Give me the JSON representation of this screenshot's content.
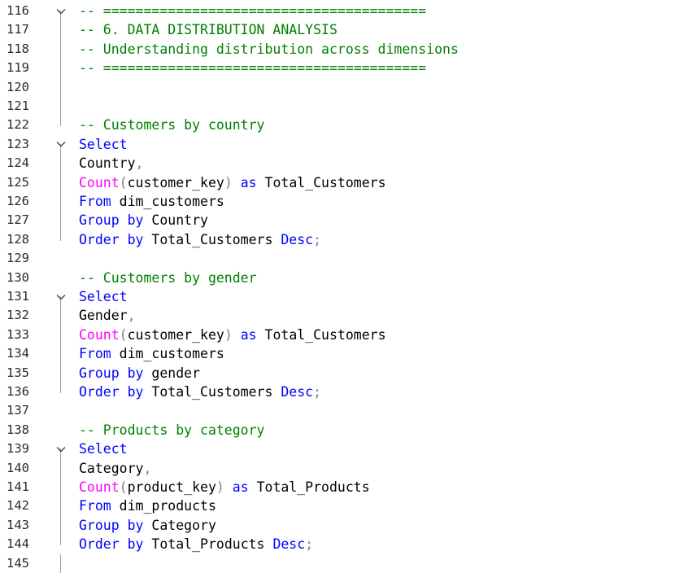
{
  "editor": {
    "language": "SQL",
    "colors": {
      "comment": "#008000",
      "keyword": "#0000ff",
      "function": "#ff00ff",
      "punctuation": "#808080",
      "identifier": "#000000",
      "line_number": "#2b2b2b"
    },
    "lines": [
      {
        "num": "116",
        "fold": "chevron-down-icon",
        "guide": "start",
        "tokens": [
          {
            "t": "-- ========================================",
            "c": "cm"
          }
        ]
      },
      {
        "num": "117",
        "guide": "mid",
        "tokens": [
          {
            "t": "-- 6. DATA DISTRIBUTION ANALYSIS",
            "c": "cm"
          }
        ]
      },
      {
        "num": "118",
        "guide": "mid",
        "tokens": [
          {
            "t": "-- Understanding distribution across dimensions",
            "c": "cm"
          }
        ]
      },
      {
        "num": "119",
        "guide": "mid",
        "tokens": [
          {
            "t": "-- ========================================",
            "c": "cm"
          }
        ]
      },
      {
        "num": "120",
        "guide": "mid",
        "tokens": []
      },
      {
        "num": "121",
        "guide": "mid",
        "tokens": []
      },
      {
        "num": "122",
        "guide": "end",
        "tokens": [
          {
            "t": "-- Customers by country",
            "c": "cm"
          }
        ]
      },
      {
        "num": "123",
        "fold": "chevron-down-icon",
        "guide": "start",
        "tokens": [
          {
            "t": "Select",
            "c": "kw"
          }
        ]
      },
      {
        "num": "124",
        "guide": "mid",
        "tokens": [
          {
            "t": "Country",
            "c": "id"
          },
          {
            "t": ",",
            "c": "pn"
          }
        ]
      },
      {
        "num": "125",
        "guide": "mid",
        "tokens": [
          {
            "t": "Count",
            "c": "fn"
          },
          {
            "t": "(",
            "c": "pn"
          },
          {
            "t": "customer_key",
            "c": "id"
          },
          {
            "t": ")",
            "c": "pn"
          },
          {
            "t": " ",
            "c": "id"
          },
          {
            "t": "as",
            "c": "kw"
          },
          {
            "t": " Total_Customers",
            "c": "id"
          }
        ]
      },
      {
        "num": "126",
        "guide": "mid",
        "tokens": [
          {
            "t": "From",
            "c": "kw"
          },
          {
            "t": " dim_customers",
            "c": "id"
          }
        ]
      },
      {
        "num": "127",
        "guide": "mid",
        "tokens": [
          {
            "t": "Group by",
            "c": "kw"
          },
          {
            "t": " Country",
            "c": "id"
          }
        ]
      },
      {
        "num": "128",
        "guide": "end",
        "tokens": [
          {
            "t": "Order by",
            "c": "kw"
          },
          {
            "t": " Total_Customers ",
            "c": "id"
          },
          {
            "t": "Desc",
            "c": "kw"
          },
          {
            "t": ";",
            "c": "pn"
          }
        ]
      },
      {
        "num": "129",
        "tokens": []
      },
      {
        "num": "130",
        "tokens": [
          {
            "t": "-- Customers by gender",
            "c": "cm"
          }
        ]
      },
      {
        "num": "131",
        "fold": "chevron-down-icon",
        "guide": "start",
        "tokens": [
          {
            "t": "Select",
            "c": "kw"
          }
        ]
      },
      {
        "num": "132",
        "guide": "mid",
        "tokens": [
          {
            "t": "Gender",
            "c": "id"
          },
          {
            "t": ",",
            "c": "pn"
          }
        ]
      },
      {
        "num": "133",
        "guide": "mid",
        "tokens": [
          {
            "t": "Count",
            "c": "fn"
          },
          {
            "t": "(",
            "c": "pn"
          },
          {
            "t": "customer_key",
            "c": "id"
          },
          {
            "t": ")",
            "c": "pn"
          },
          {
            "t": " ",
            "c": "id"
          },
          {
            "t": "as",
            "c": "kw"
          },
          {
            "t": " Total_Customers",
            "c": "id"
          }
        ]
      },
      {
        "num": "134",
        "guide": "mid",
        "tokens": [
          {
            "t": "From",
            "c": "kw"
          },
          {
            "t": " dim_customers",
            "c": "id"
          }
        ]
      },
      {
        "num": "135",
        "guide": "mid",
        "tokens": [
          {
            "t": "Group by",
            "c": "kw"
          },
          {
            "t": " gender",
            "c": "id"
          }
        ]
      },
      {
        "num": "136",
        "guide": "end",
        "tokens": [
          {
            "t": "Order by",
            "c": "kw"
          },
          {
            "t": " Total_Customers ",
            "c": "id"
          },
          {
            "t": "Desc",
            "c": "kw"
          },
          {
            "t": ";",
            "c": "pn"
          }
        ]
      },
      {
        "num": "137",
        "tokens": []
      },
      {
        "num": "138",
        "tokens": [
          {
            "t": "-- Products by category",
            "c": "cm"
          }
        ]
      },
      {
        "num": "139",
        "fold": "chevron-down-icon",
        "guide": "start",
        "tokens": [
          {
            "t": "Select",
            "c": "kw"
          }
        ]
      },
      {
        "num": "140",
        "guide": "mid",
        "tokens": [
          {
            "t": "Category",
            "c": "id"
          },
          {
            "t": ",",
            "c": "pn"
          }
        ]
      },
      {
        "num": "141",
        "guide": "mid",
        "tokens": [
          {
            "t": "Count",
            "c": "fn"
          },
          {
            "t": "(",
            "c": "pn"
          },
          {
            "t": "product_key",
            "c": "id"
          },
          {
            "t": ")",
            "c": "pn"
          },
          {
            "t": " ",
            "c": "id"
          },
          {
            "t": "as",
            "c": "kw"
          },
          {
            "t": " Total_Products",
            "c": "id"
          }
        ]
      },
      {
        "num": "142",
        "guide": "mid",
        "tokens": [
          {
            "t": "From",
            "c": "kw"
          },
          {
            "t": " dim_products",
            "c": "id"
          }
        ]
      },
      {
        "num": "143",
        "guide": "mid",
        "tokens": [
          {
            "t": "Group by",
            "c": "kw"
          },
          {
            "t": " Category",
            "c": "id"
          }
        ]
      },
      {
        "num": "144",
        "guide": "end",
        "tokens": [
          {
            "t": "Order by",
            "c": "kw"
          },
          {
            "t": " Total_Products ",
            "c": "id"
          },
          {
            "t": "Desc",
            "c": "kw"
          },
          {
            "t": ";",
            "c": "pn"
          }
        ]
      },
      {
        "num": "145",
        "guide": "mid",
        "tokens": []
      }
    ]
  }
}
